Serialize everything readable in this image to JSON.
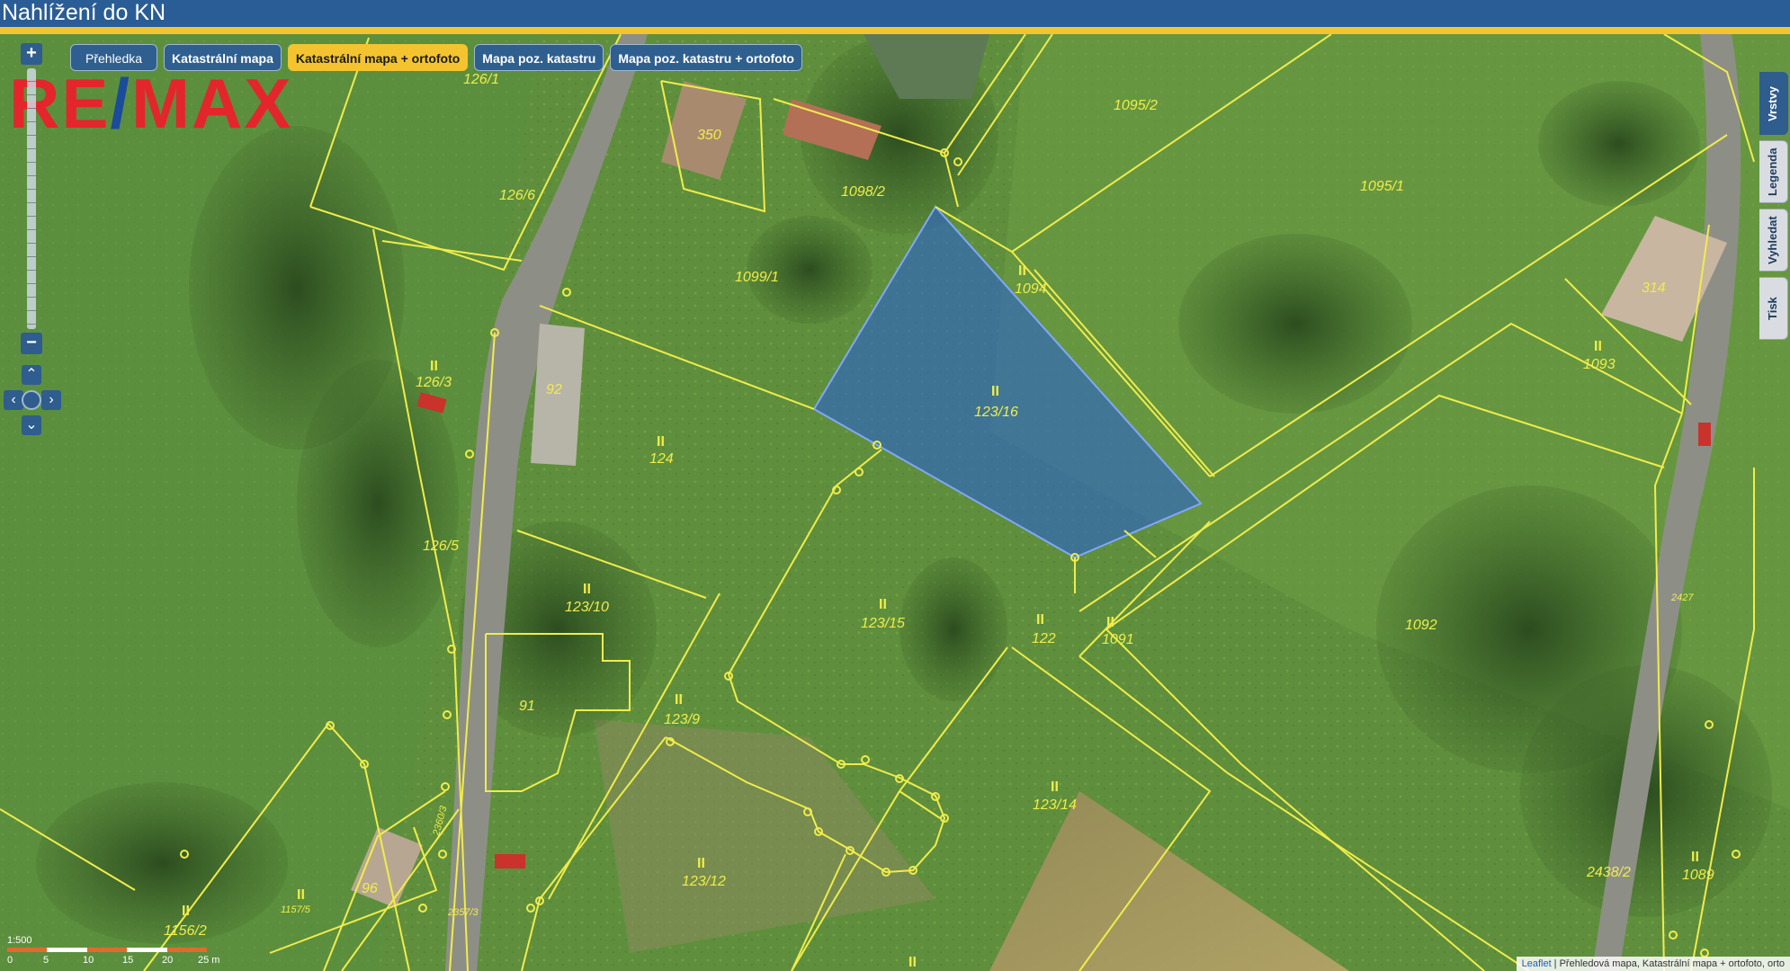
{
  "header": {
    "title": "Nahlížení do KN"
  },
  "logo": {
    "part1": "RE",
    "slash": "/",
    "part2": "MAX"
  },
  "map_tabs": [
    {
      "label": "Přehledka",
      "active": false
    },
    {
      "label": "Katastrální mapa",
      "active": false
    },
    {
      "label": "Katastrální mapa + ortofoto",
      "active": true
    },
    {
      "label": "Mapa poz. katastru",
      "active": false
    },
    {
      "label": "Mapa poz. katastru + ortofoto",
      "active": false
    }
  ],
  "right_tabs": [
    {
      "label": "Vrstvy",
      "active": true
    },
    {
      "label": "Legenda",
      "active": false
    },
    {
      "label": "Vyhledat",
      "active": false
    },
    {
      "label": "Tisk",
      "active": false
    }
  ],
  "zoom": {
    "plus": "+",
    "minus": "−"
  },
  "pan": {
    "up": "⌃",
    "down": "⌄",
    "left": "‹",
    "right": "›"
  },
  "scale": {
    "ratio": "1:500",
    "ticks": [
      "0",
      "5",
      "10",
      "15",
      "20",
      "25 m"
    ]
  },
  "attribution": {
    "link": "Leaflet",
    "text": " | Přehledová mapa, Katastrální mapa + ortofoto, orto"
  },
  "parcels": {
    "selected": "123/16",
    "labels": [
      "126/1",
      "350",
      "1098/2",
      "1095/2",
      "1095/1",
      "126/6",
      "1099/1",
      "1094",
      "126/3",
      "92",
      "124",
      "123/16",
      "1093",
      "126/5",
      "123/10",
      "123/15",
      "122",
      "1091",
      "1092",
      "91",
      "123/9",
      "123/14",
      "2427",
      "123/12",
      "2438/2",
      "1089",
      "1156/2",
      "96",
      "1157/5",
      "2357/3",
      "2360/3",
      "314"
    ]
  },
  "colors": {
    "header_bg": "#2a5d95",
    "header_accent": "#f4c430",
    "parcel_line": "#f1ec4b",
    "selection_fill": "#2b63c9",
    "tab_active": "#f4c430",
    "logo_red": "#e4252c",
    "logo_blue": "#1a4b9c"
  }
}
